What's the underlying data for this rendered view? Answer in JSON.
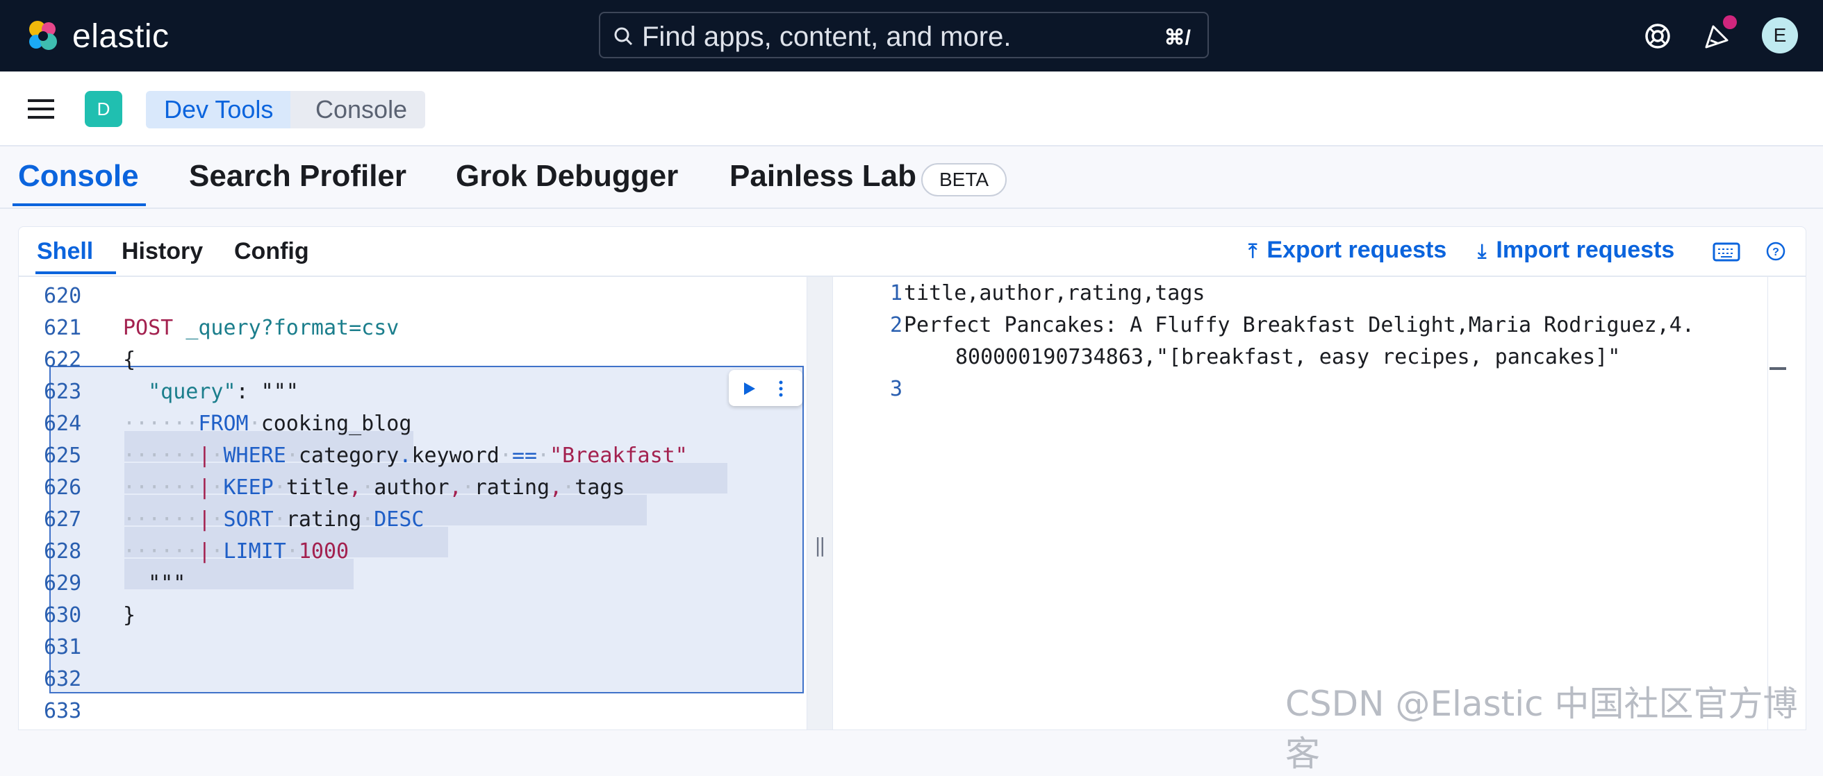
{
  "header": {
    "brand": "elastic",
    "search_placeholder": "Find apps, content, and more.",
    "search_shortcut": "⌘/",
    "avatar_initial": "E"
  },
  "breadcrumb": {
    "space_initial": "D",
    "items": [
      "Dev Tools",
      "Console"
    ]
  },
  "tabs": [
    {
      "label": "Console"
    },
    {
      "label": "Search Profiler"
    },
    {
      "label": "Grok Debugger"
    },
    {
      "label": "Painless Lab"
    }
  ],
  "beta_badge": "BETA",
  "subtabs": [
    {
      "label": "Shell"
    },
    {
      "label": "History"
    },
    {
      "label": "Config"
    }
  ],
  "actions": {
    "export": "Export requests",
    "import": "Import requests"
  },
  "editor": {
    "line_numbers": [
      "620",
      "621",
      "622",
      "623",
      "624",
      "625",
      "626",
      "627",
      "628",
      "629",
      "630",
      "631",
      "632",
      "633"
    ],
    "method": "POST",
    "path": "_query?format=csv",
    "open_brace": "{",
    "query_key": "\"query\"",
    "query_sep": ": \"\"\"",
    "from_kw": "FROM",
    "from_src": "cooking_blog",
    "pipe": "|",
    "where_kw": "WHERE",
    "where_field": "category",
    "where_dot": ".",
    "where_sub": "keyword",
    "where_op": "==",
    "where_val": "\"Breakfast\"",
    "keep_kw": "KEEP",
    "keep_f1": "title",
    "keep_f2": "author",
    "keep_f3": "rating",
    "keep_f4": "tags",
    "comma": ",",
    "sort_kw": "SORT",
    "sort_field": "rating",
    "sort_dir": "DESC",
    "limit_kw": "LIMIT",
    "limit_val": "1000",
    "close_triple": "\"\"\"",
    "close_brace": "}"
  },
  "output": {
    "line_numbers": [
      "1",
      "2",
      "3"
    ],
    "line1": "title,author,rating,tags",
    "line2a": "Perfect Pancakes: A Fluffy Breakfast Delight,Maria Rodriguez,4.",
    "line2b": "800000190734863,\"[breakfast, easy recipes, pancakes]\""
  },
  "watermark": "CSDN @Elastic 中国社区官方博客",
  "icons": [
    "search-icon",
    "help-ring-icon",
    "newsfeed-icon",
    "menu-icon",
    "play-icon",
    "kebab-icon",
    "export-icon",
    "import-icon",
    "keyboard-icon",
    "help-icon"
  ]
}
